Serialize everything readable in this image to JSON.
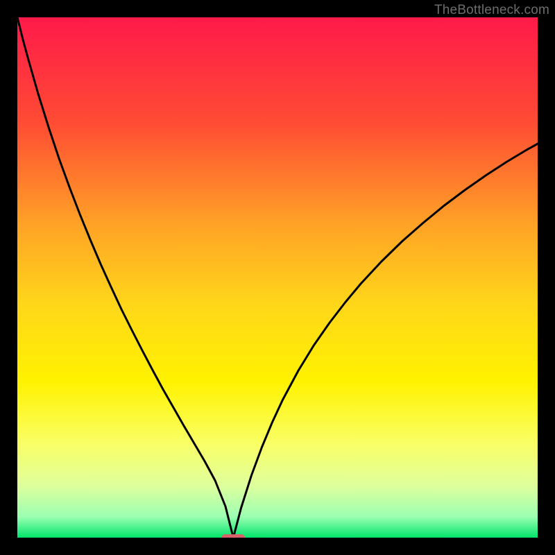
{
  "watermark": "TheBottleneck.com",
  "chart_data": {
    "type": "line",
    "title": "",
    "xlabel": "",
    "ylabel": "",
    "xlim": [
      0,
      100
    ],
    "ylim": [
      0,
      100
    ],
    "grid": false,
    "legend": false,
    "background": {
      "type": "vertical-gradient",
      "stops": [
        {
          "pos": 0.0,
          "color": "#ff1a4a"
        },
        {
          "pos": 0.2,
          "color": "#ff4b34"
        },
        {
          "pos": 0.4,
          "color": "#ffa326"
        },
        {
          "pos": 0.55,
          "color": "#ffd61a"
        },
        {
          "pos": 0.7,
          "color": "#fff200"
        },
        {
          "pos": 0.82,
          "color": "#f9ff66"
        },
        {
          "pos": 0.9,
          "color": "#dfff9d"
        },
        {
          "pos": 0.96,
          "color": "#9bffb2"
        },
        {
          "pos": 1.0,
          "color": "#00e56a"
        }
      ]
    },
    "min_marker": {
      "x": 41.5,
      "y": 0,
      "width": 4.5,
      "height": 1.3,
      "color": "#d9626a"
    },
    "series": [
      {
        "name": "left-curve",
        "x": [
          0.0,
          1,
          2,
          4,
          6,
          8,
          10,
          12,
          14,
          16,
          18,
          20,
          22,
          24,
          26,
          28,
          30,
          32,
          34,
          36,
          38,
          40,
          41.5
        ],
        "y": [
          100,
          96,
          92.3,
          85.3,
          78.9,
          72.9,
          67.4,
          62.2,
          57.3,
          52.6,
          48.2,
          43.9,
          39.9,
          36.0,
          32.2,
          28.5,
          25.0,
          21.5,
          18.1,
          14.7,
          11.0,
          6.0,
          0.0
        ]
      },
      {
        "name": "right-curve",
        "x": [
          41.5,
          43,
          45,
          47,
          49,
          51,
          54,
          57,
          60,
          63,
          66,
          70,
          74,
          78,
          82,
          86,
          90,
          94,
          98,
          100
        ],
        "y": [
          0.0,
          5.7,
          12.0,
          17.4,
          22.2,
          26.5,
          32.1,
          37.0,
          41.3,
          45.2,
          48.8,
          53.1,
          57.0,
          60.5,
          63.8,
          66.8,
          69.6,
          72.2,
          74.6,
          75.7
        ]
      }
    ]
  }
}
